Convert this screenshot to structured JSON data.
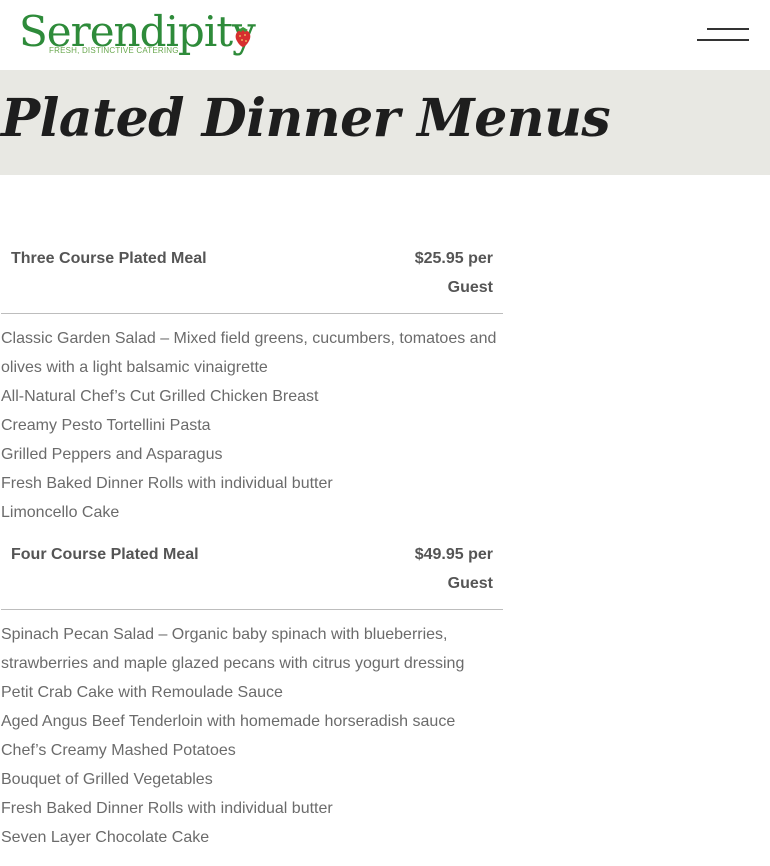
{
  "header": {
    "logo_text": "Serendipity",
    "logo_tagline": "FRESH, DISTINCTIVE CATERING",
    "menu_icon": "hamburger-icon"
  },
  "banner": {
    "title": "Plated Dinner Menus"
  },
  "menus": [
    {
      "name": "Three Course Plated Meal",
      "price": "$25.95 per Guest",
      "items": [
        "Classic Garden Salad – Mixed field greens, cucumbers, tomatoes and olives with a light balsamic vinaigrette",
        "All-Natural Chef’s Cut Grilled Chicken Breast",
        "Creamy Pesto Tortellini Pasta",
        "Grilled Peppers and Asparagus",
        "Fresh Baked Dinner Rolls with individual butter",
        "Limoncello Cake"
      ]
    },
    {
      "name": "Four Course Plated Meal",
      "price": "$49.95 per Guest",
      "items": [
        "Spinach Pecan Salad – Organic baby spinach with blueberries, strawberries and maple glazed pecans with citrus yogurt dressing",
        "Petit Crab Cake with Remoulade Sauce",
        "Aged Angus Beef Tenderloin with homemade horseradish sauce",
        "Chef’s Creamy Mashed Potatoes",
        "Bouquet of Grilled Vegetables",
        "Fresh Baked Dinner Rolls with individual butter",
        "Seven Layer Chocolate Cake"
      ]
    }
  ],
  "colors": {
    "brand_green": "#2e8b3a",
    "banner_bg": "#e8e8e3",
    "strawberry_red": "#d62f2f"
  }
}
